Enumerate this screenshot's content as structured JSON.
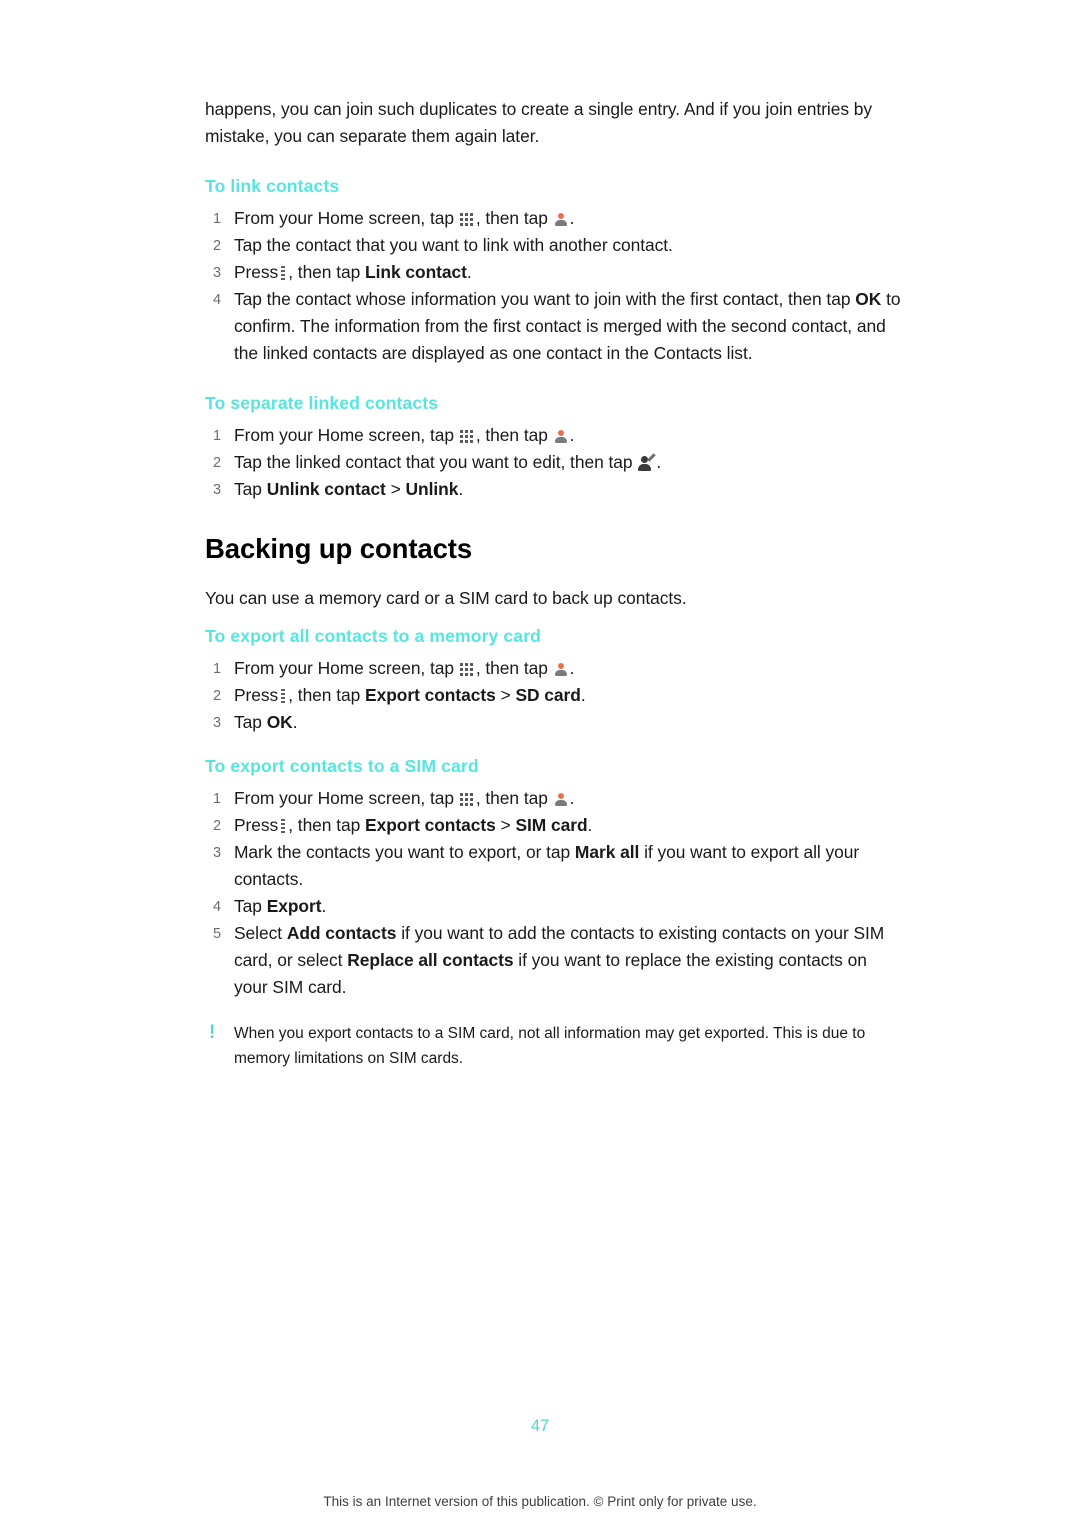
{
  "document": {
    "intro_paragraph": "happens, you can join such duplicates to create a single entry. And if you join entries by mistake, you can separate them again later.",
    "sections": [
      {
        "heading": "To link contacts",
        "steps": [
          "From your Home screen, tap",
          "Tap the contact that you want to link with another contact.",
          "Press",
          "Tap the contact whose information you want to join with the first contact, then tap OK to confirm. The information from the first contact is merged with the second contact, and the linked contacts are displayed as one contact in the Contacts list."
        ]
      },
      {
        "heading": "To separate linked contacts",
        "steps": [
          "From your Home screen, tap",
          "Tap the linked contact that you want to edit, then tap",
          "Tap Unlink contact > Unlink."
        ]
      }
    ],
    "main_heading": "Backing up contacts",
    "main_paragraph": "You can use a memory card or a SIM card to back up contacts.",
    "section_memory_card": {
      "heading": "To export all contacts to a memory card",
      "steps": [
        "From your Home screen, tap",
        "Press",
        "Tap OK."
      ]
    },
    "section_sim_card": {
      "heading": "To export contacts to a SIM card",
      "steps": [
        "From your Home screen, tap",
        "Press",
        "Mark the contacts you want to export, or tap Mark all if you want to export all your contacts.",
        "Tap Export.",
        "Select Add contacts if you want to add the contacts to existing contacts on your SIM card, or select Replace all contacts if you want to replace the existing contacts on your SIM card."
      ]
    },
    "note": "When you export contacts to a SIM card, not all information may get exported. This is due to memory limitations on SIM cards.",
    "page_number": "47",
    "footer": "This is an Internet version of this publication. © Print only for private use."
  },
  "fragments": {
    "then_tap": ", then tap",
    "period": ".",
    "press": "Press",
    "comma_then_tap": ", then tap",
    "link_contact": "Link contact",
    "tap_step4_a": "Tap the contact whose information you want to join with the first contact, then tap",
    "ok": "OK",
    "tap_step4_b": "to confirm. The information from the first contact is merged with the second contact, and the linked contacts are displayed as one contact in the Contacts list.",
    "tap_linked_contact": "Tap the linked contact that you want to edit, then tap",
    "tap": "Tap",
    "unlink_contact": "Unlink contact",
    "gt": ">",
    "unlink": "Unlink",
    "export_contacts": "Export contacts",
    "sd_card": "SD card",
    "tap_ok": "Tap",
    "sim_card": "SIM card",
    "mark_step_a": "Mark the contacts you want to export, or tap",
    "mark_all": "Mark all",
    "mark_step_b": "if you want to export all your contacts.",
    "export": "Export",
    "select": "Select",
    "add_contacts": "Add contacts",
    "select_step_b": "if you want to add the contacts to existing contacts on your SIM card, or select",
    "replace_all_contacts": "Replace all contacts",
    "select_step_c": "if you want to replace the existing contacts on your SIM card.",
    "tap_the_contact_link": "Tap the contact that you want to link with another contact.",
    "bang": "!"
  },
  "colors": {
    "accent": "#55e6e0",
    "body_text": "#1a1a1a",
    "step_number": "#6d6d6d"
  }
}
